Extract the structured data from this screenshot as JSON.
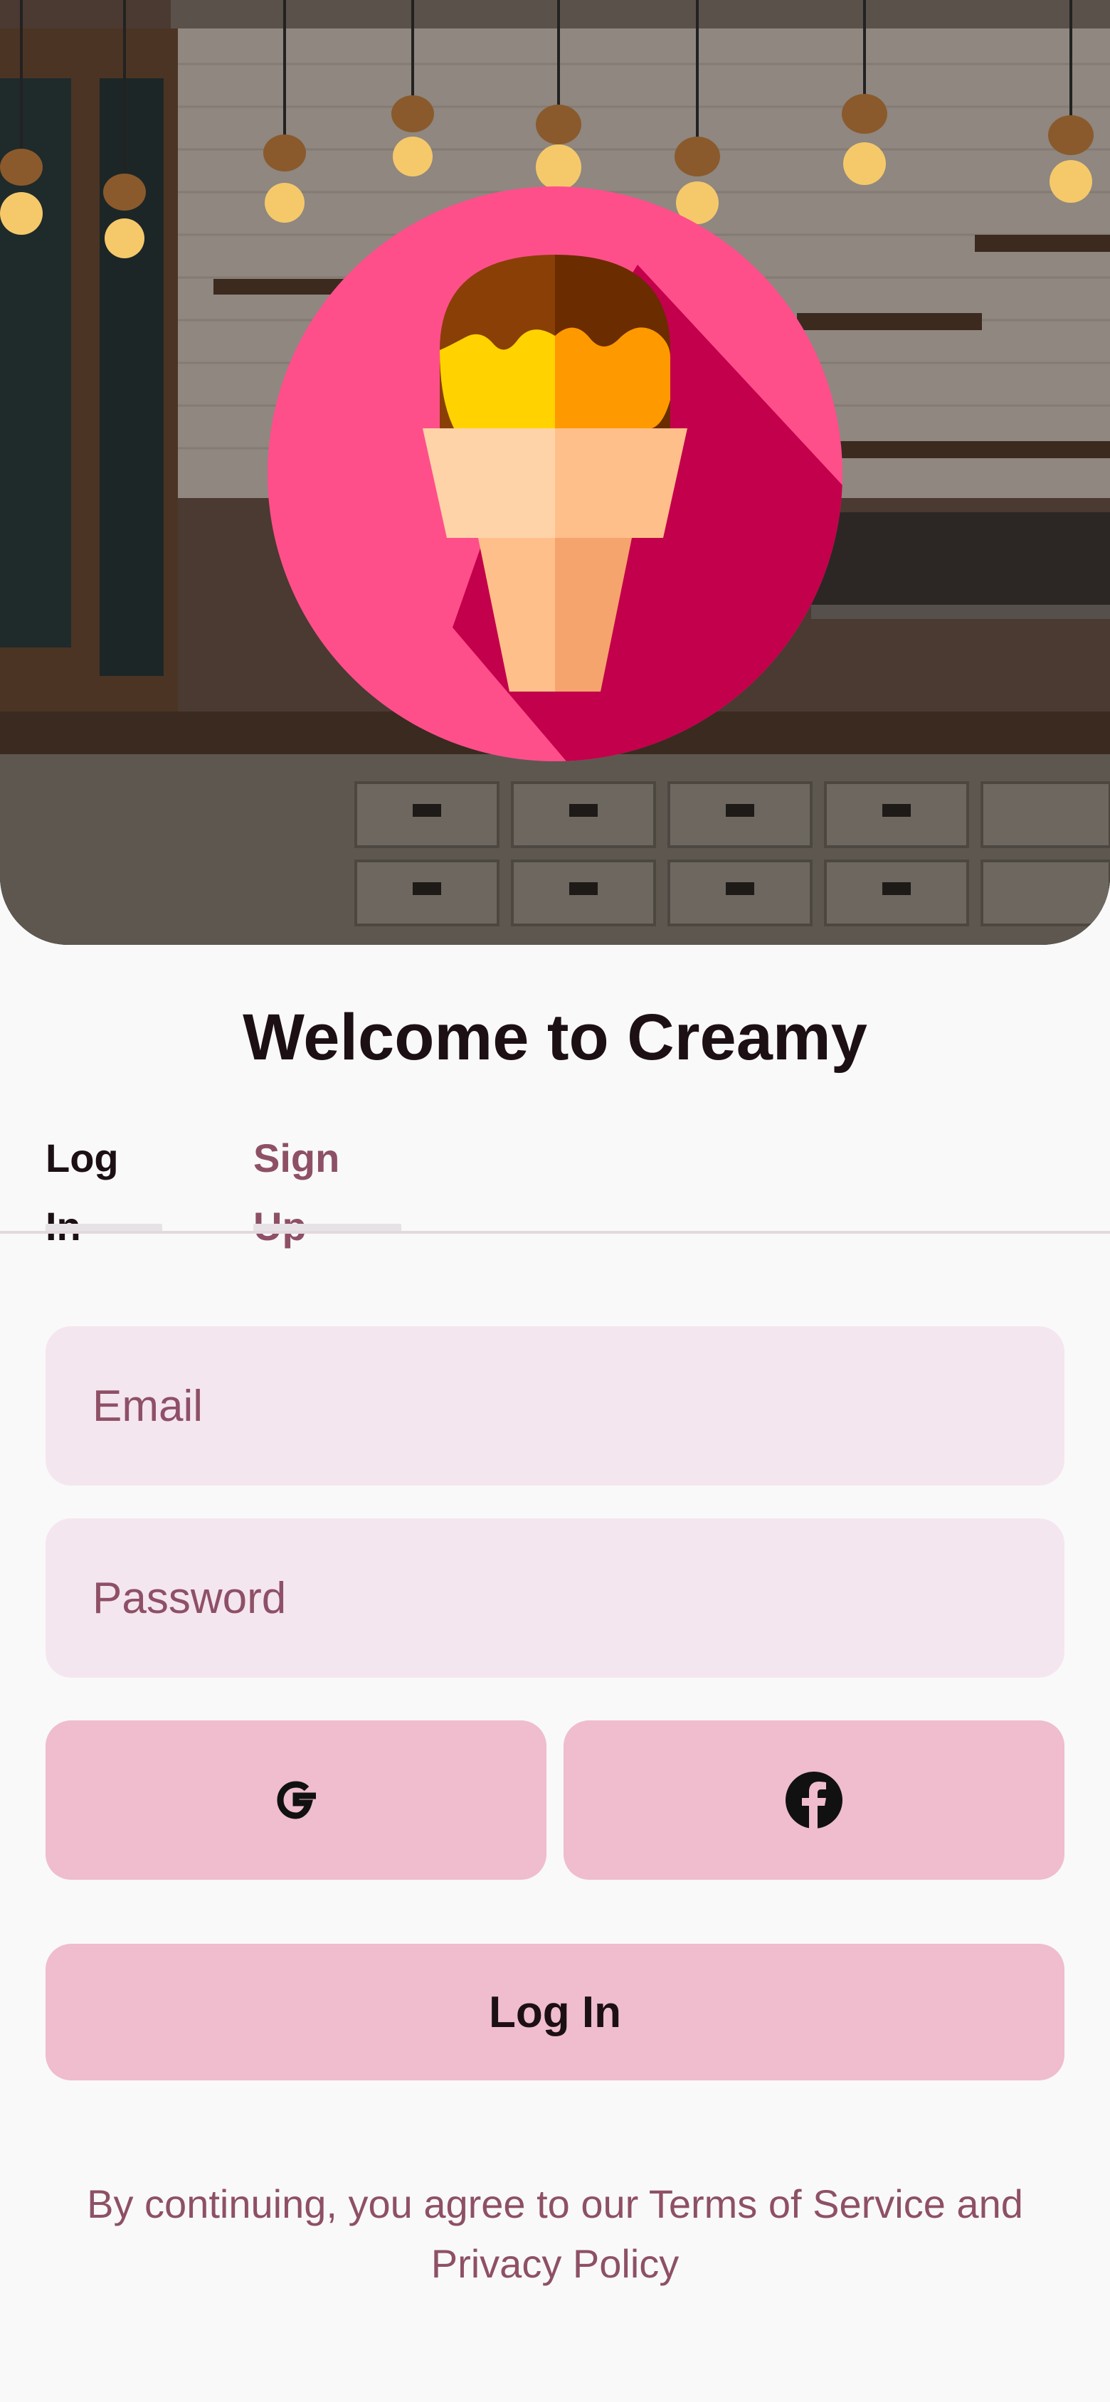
{
  "hero": {
    "background": "cafe-interior-photo",
    "logo": "ice-cream-cone-icon"
  },
  "title": "Welcome to Creamy",
  "tabs": [
    {
      "label": "Log In",
      "active": true
    },
    {
      "label": "Sign Up",
      "active": false
    }
  ],
  "form": {
    "email_placeholder": "Email",
    "password_placeholder": "Password",
    "email_value": "",
    "password_value": ""
  },
  "social": {
    "google_icon": "google-icon",
    "facebook_icon": "facebook-icon"
  },
  "login_button": "Log In",
  "legal": {
    "prefix": "By continuing, you agree to our ",
    "terms": "Terms of Service",
    "and": " and ",
    "privacy": "Privacy Policy"
  },
  "colors": {
    "background": "#f9f9f9",
    "accent": "#efbdcd",
    "field": "#f4e6ee",
    "muted_text": "#8e5066",
    "primary_text": "#1c1014",
    "logo_circle": "#ff4f8b"
  }
}
